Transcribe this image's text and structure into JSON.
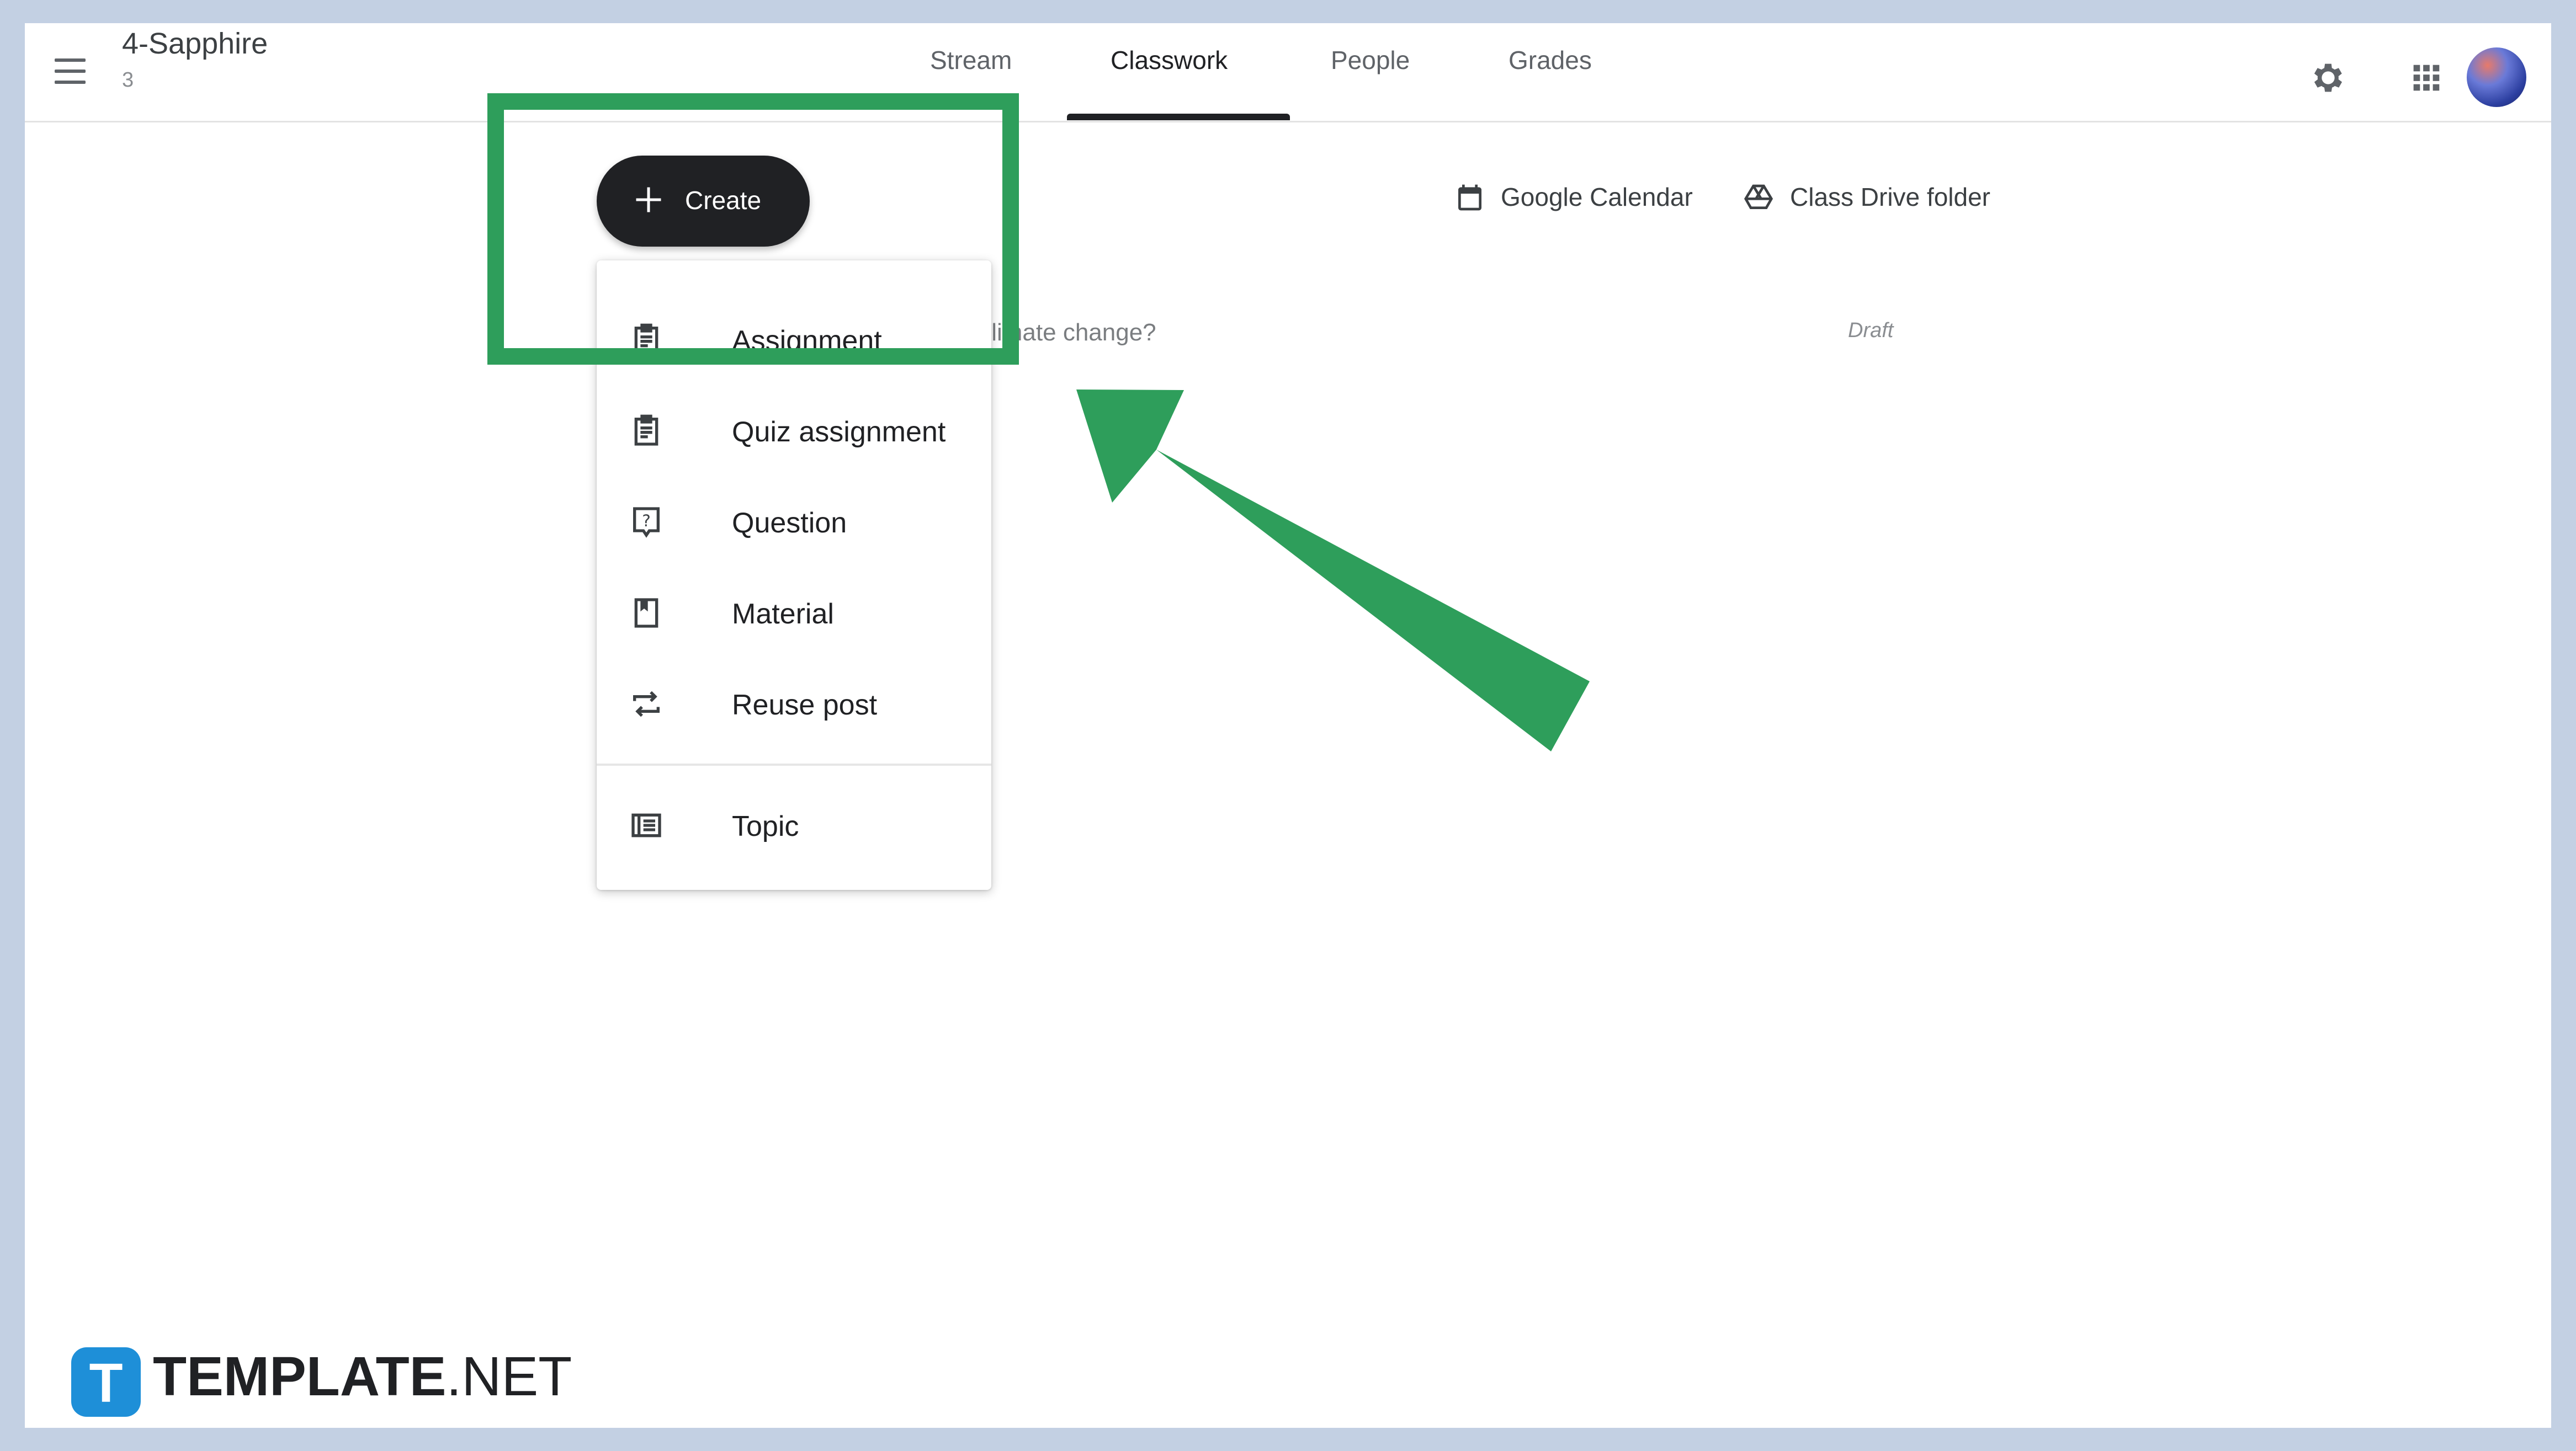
{
  "header": {
    "class_name": "4-Sapphire",
    "section": "3",
    "tabs": [
      {
        "label": "Stream"
      },
      {
        "label": "Classwork"
      },
      {
        "label": "People"
      },
      {
        "label": "Grades"
      }
    ],
    "active_tab": "Classwork",
    "icons": [
      "menu-icon",
      "gear-icon",
      "apps-grid-icon",
      "avatar"
    ]
  },
  "toolbar": {
    "create_label": "Create",
    "calendar_label": "Google Calendar",
    "drive_label": "Class Drive folder"
  },
  "background_item": {
    "title_fragment": "s climate change?",
    "status": "Draft"
  },
  "create_menu": {
    "items": [
      {
        "label": "Assignment",
        "icon": "assignment-icon"
      },
      {
        "label": "Quiz assignment",
        "icon": "quiz-icon"
      },
      {
        "label": "Question",
        "icon": "question-icon"
      },
      {
        "label": "Material",
        "icon": "material-icon"
      },
      {
        "label": "Reuse post",
        "icon": "reuse-icon"
      },
      {
        "label": "Topic",
        "icon": "topic-icon"
      }
    ]
  },
  "watermark": {
    "logo_letter": "T",
    "brand_bold": "TEMPLATE",
    "brand_suffix": ".NET"
  },
  "colors": {
    "highlight": "#2e9e5b",
    "frame": "#c3d0e3",
    "create_button": "#202124",
    "watermark_logo": "#1e8fd8"
  }
}
